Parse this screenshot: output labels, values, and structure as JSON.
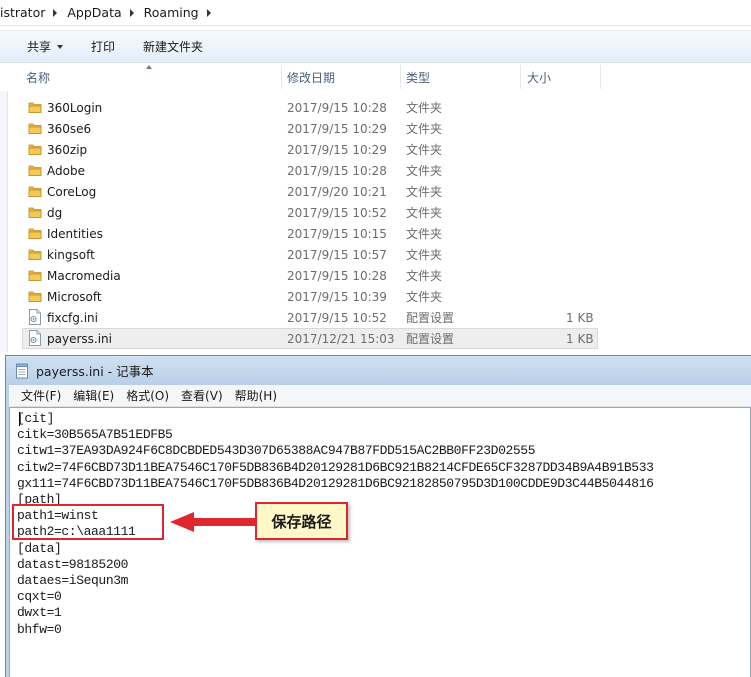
{
  "explorer": {
    "breadcrumbs": [
      "istrator",
      "AppData",
      "Roaming"
    ],
    "toolbar": {
      "share_label": "共享",
      "burn_label": "打印",
      "new_folder_label": "新建文件夹"
    },
    "columns": {
      "name": "名称",
      "date": "修改日期",
      "type": "类型",
      "size": "大小"
    },
    "files": [
      {
        "name": "360Login",
        "date": "2017/9/15 10:28",
        "type": "文件夹",
        "size": "",
        "icon": "folder-icon"
      },
      {
        "name": "360se6",
        "date": "2017/9/15 10:29",
        "type": "文件夹",
        "size": "",
        "icon": "folder-icon"
      },
      {
        "name": "360zip",
        "date": "2017/9/15 10:29",
        "type": "文件夹",
        "size": "",
        "icon": "folder-icon"
      },
      {
        "name": "Adobe",
        "date": "2017/9/15 10:28",
        "type": "文件夹",
        "size": "",
        "icon": "folder-icon"
      },
      {
        "name": "CoreLog",
        "date": "2017/9/20 10:21",
        "type": "文件夹",
        "size": "",
        "icon": "folder-icon"
      },
      {
        "name": "dg",
        "date": "2017/9/15 10:52",
        "type": "文件夹",
        "size": "",
        "icon": "folder-icon"
      },
      {
        "name": "Identities",
        "date": "2017/9/15 10:15",
        "type": "文件夹",
        "size": "",
        "icon": "folder-icon"
      },
      {
        "name": "kingsoft",
        "date": "2017/9/15 10:57",
        "type": "文件夹",
        "size": "",
        "icon": "folder-icon"
      },
      {
        "name": "Macromedia",
        "date": "2017/9/15 10:28",
        "type": "文件夹",
        "size": "",
        "icon": "folder-icon"
      },
      {
        "name": "Microsoft",
        "date": "2017/9/15 10:39",
        "type": "文件夹",
        "size": "",
        "icon": "folder-icon"
      },
      {
        "name": "fixcfg.ini",
        "date": "2017/9/15 10:52",
        "type": "配置设置",
        "size": "1 KB",
        "icon": "ini-file-icon"
      },
      {
        "name": "payerss.ini",
        "date": "2017/12/21 15:03",
        "type": "配置设置",
        "size": "1 KB",
        "icon": "ini-file-icon",
        "selected": true
      }
    ]
  },
  "notepad": {
    "title": "payerss.ini - 记事本",
    "menu": [
      "文件(F)",
      "编辑(E)",
      "格式(O)",
      "查看(V)",
      "帮助(H)"
    ],
    "lines": [
      "[cit]",
      "citk=30B565A7B51EDFB5",
      "citw1=37EA93DA924F6C8DCBDED543D307D65388AC947B87FDD515AC2BB0FF23D02555",
      "citw2=74F6CBD73D11BEA7546C170F5DB836B4D20129281D6BC921B8214CFDE65CF3287DD34B9A4B91B533",
      "gx111=74F6CBD73D11BEA7546C170F5DB836B4D20129281D6BC92182850795D3D100CDDE9D3C44B5044816",
      "[path]",
      "path1=winst",
      "path2=c:\\aaa1111",
      "[data]",
      "datast=98185200",
      "dataes=iSequn3m",
      "cqxt=0",
      "dwxt=1",
      "bhfw=0"
    ]
  },
  "annotation": {
    "callout_text": "保存路径",
    "color": "#e0262e"
  },
  "colors": {
    "folder": "#e8b33a",
    "selection": "#eeeeee",
    "title_bar": "#c3d6ec"
  }
}
